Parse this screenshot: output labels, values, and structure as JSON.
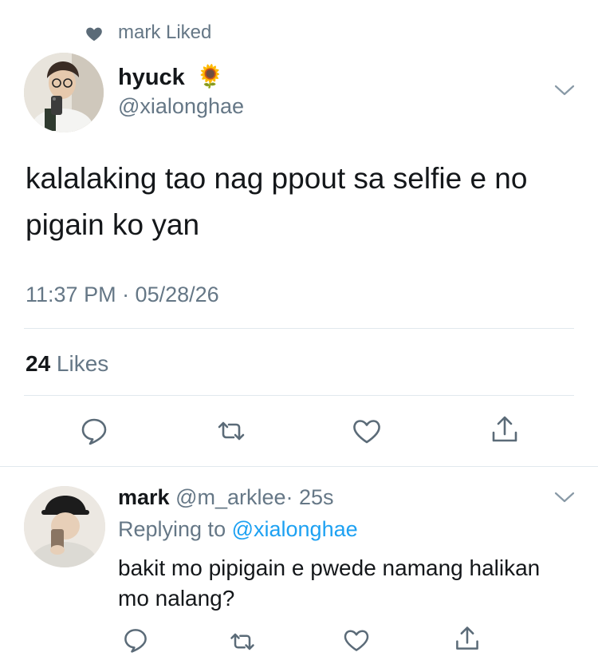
{
  "context": {
    "text": "mark Liked",
    "icon": "heart-filled-icon"
  },
  "tweet": {
    "name": "hyuck",
    "emoji": "🌻",
    "handle": "@xialonghae",
    "text": "kalalaking tao nag ppout sa selfie e no pigain ko yan",
    "timestamp": "11:37 PM · 05/28/26",
    "likes_count": "24",
    "likes_label": " Likes",
    "actions": [
      "reply-icon",
      "retweet-icon",
      "like-icon",
      "share-icon"
    ]
  },
  "reply": {
    "name": "mark",
    "handle": "@m_arklee",
    "time": "· 25s",
    "replying_prefix": "Replying to ",
    "replying_handle": "@xialonghae",
    "text": "bakit mo pipigain e pwede namang halikan mo nalang?"
  },
  "colors": {
    "muted": "#657786",
    "link": "#1da1f2",
    "text": "#14171a",
    "divider": "#e1e8ed"
  }
}
